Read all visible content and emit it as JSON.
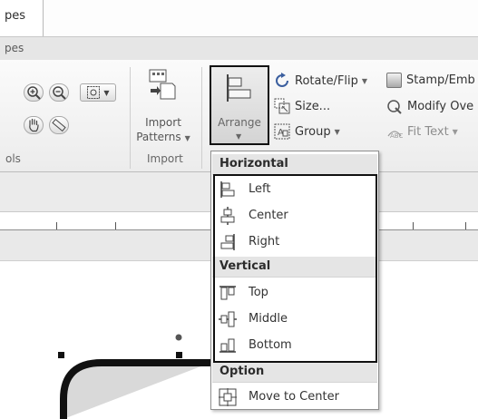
{
  "title_tab": {
    "label": "pes"
  },
  "tab_row": {
    "label": "pes"
  },
  "ribbon": {
    "tools_group_label": "ols",
    "import_group": {
      "button_label_line1": "Import",
      "button_label_line2": "Patterns",
      "group_label": "Import"
    },
    "arrange": {
      "label": "Arrange"
    },
    "rotate_flip": {
      "label": "Rotate/Flip"
    },
    "size": {
      "label": "Size..."
    },
    "group": {
      "label": "Group"
    },
    "stamp": {
      "label": "Stamp/Emb"
    },
    "modify": {
      "label": "Modify Ove"
    },
    "fit_text": {
      "label": "Fit Text"
    }
  },
  "menu": {
    "sections": [
      {
        "header": "Horizontal",
        "items": [
          {
            "label": "Left",
            "icon": "align-left-icon"
          },
          {
            "label": "Center",
            "icon": "align-center-icon"
          },
          {
            "label": "Right",
            "icon": "align-right-icon"
          }
        ]
      },
      {
        "header": "Vertical",
        "items": [
          {
            "label": "Top",
            "icon": "align-top-icon"
          },
          {
            "label": "Middle",
            "icon": "align-middle-icon"
          },
          {
            "label": "Bottom",
            "icon": "align-bottom-icon"
          }
        ]
      },
      {
        "header": "Option",
        "items": [
          {
            "label": "Move to Center",
            "icon": "move-to-center-icon"
          }
        ]
      }
    ]
  }
}
